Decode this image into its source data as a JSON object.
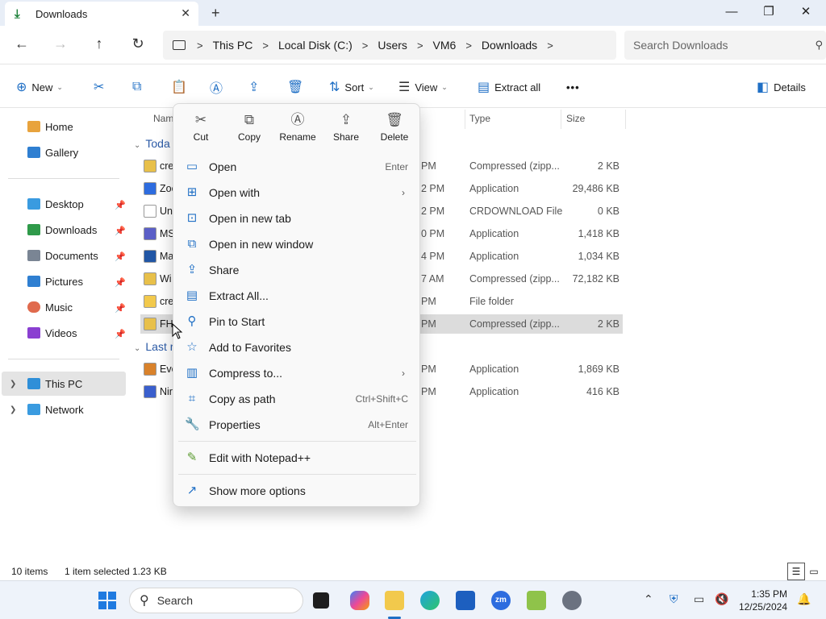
{
  "window": {
    "tab_title": "Downloads",
    "close_tab": "✕",
    "new_tab": "+",
    "minimize": "—",
    "maximize": "❐",
    "close": "✕"
  },
  "address": {
    "back": "←",
    "forward": "→",
    "up": "↑",
    "refresh": "↻",
    "crumbs": [
      "This PC",
      "Local Disk (C:)",
      "Users",
      "VM6",
      "Downloads"
    ],
    "separator": ">",
    "search_placeholder": "Search Downloads"
  },
  "commandbar": {
    "new": "New",
    "sort": "Sort",
    "view": "View",
    "extract_all": "Extract all",
    "more": "•••",
    "details": "Details"
  },
  "sidebar": {
    "quick": [
      {
        "label": "Home",
        "color": "#e8a33d"
      },
      {
        "label": "Gallery",
        "color": "#2f7fd1"
      }
    ],
    "pinned": [
      {
        "label": "Desktop",
        "color": "#3a9be0"
      },
      {
        "label": "Downloads",
        "color": "#2f9a4a"
      },
      {
        "label": "Documents",
        "color": "#7a8594"
      },
      {
        "label": "Pictures",
        "color": "#2f7fd1"
      },
      {
        "label": "Music",
        "color": "#e06a4d"
      },
      {
        "label": "Videos",
        "color": "#8a3fd1"
      }
    ],
    "pin_glyph": "📌",
    "this_pc": "This PC",
    "network": "Network"
  },
  "list": {
    "headers": {
      "name": "Nam",
      "type": "Type",
      "size": "Size"
    },
    "groups": {
      "today": "Toda",
      "last": "Last r"
    },
    "rows": [
      {
        "name": "cre",
        "date": "PM",
        "type": "Compressed (zipp...",
        "size": "2 KB",
        "color": "#e8c04a"
      },
      {
        "name": "Zoo",
        "date": "2 PM",
        "type": "Application",
        "size": "29,486 KB",
        "color": "#2d6cdf"
      },
      {
        "name": "Un",
        "date": "2 PM",
        "type": "CRDOWNLOAD File",
        "size": "0 KB",
        "color": "#ffffff"
      },
      {
        "name": "MS",
        "date": "0 PM",
        "type": "Application",
        "size": "1,418 KB",
        "color": "#5b5fc7"
      },
      {
        "name": "Ma",
        "date": "4 PM",
        "type": "Application",
        "size": "1,034 KB",
        "color": "#2156a5"
      },
      {
        "name": "Wi",
        "date": "7 AM",
        "type": "Compressed (zipp...",
        "size": "72,182 KB",
        "color": "#e8c04a"
      },
      {
        "name": "cre",
        "date": "PM",
        "type": "File folder",
        "size": "",
        "color": "#f2c94c"
      },
      {
        "name": "FH",
        "date": "PM",
        "type": "Compressed (zipp...",
        "size": "2 KB",
        "color": "#e8c04a"
      }
    ],
    "last_rows": [
      {
        "name": "Eve",
        "date": "PM",
        "type": "Application",
        "size": "1,869 KB",
        "color": "#d9822b"
      },
      {
        "name": "Nir",
        "date": "PM",
        "type": "Application",
        "size": "416 KB",
        "color": "#3a5fcd"
      }
    ]
  },
  "context_menu": {
    "quick_actions": [
      {
        "label": "Cut",
        "glyph": "✂"
      },
      {
        "label": "Copy",
        "glyph": "⧉"
      },
      {
        "label": "Rename",
        "glyph": "Ⓐ"
      },
      {
        "label": "Share",
        "glyph": "⇪"
      },
      {
        "label": "Delete",
        "glyph": "🗑"
      }
    ],
    "items": [
      {
        "label": "Open",
        "shortcut": "Enter",
        "glyph": "▭"
      },
      {
        "label": "Open with",
        "arrow": "›",
        "glyph": "⊞"
      },
      {
        "label": "Open in new tab",
        "glyph": "⊡"
      },
      {
        "label": "Open in new window",
        "glyph": "⧉"
      },
      {
        "label": "Share",
        "glyph": "⇪"
      },
      {
        "label": "Extract All...",
        "glyph": "▤"
      },
      {
        "label": "Pin to Start",
        "glyph": "⚲"
      },
      {
        "label": "Add to Favorites",
        "glyph": "☆"
      },
      {
        "label": "Compress to...",
        "arrow": "›",
        "glyph": "▥"
      },
      {
        "label": "Copy as path",
        "shortcut": "Ctrl+Shift+C",
        "glyph": "⌗"
      },
      {
        "label": "Properties",
        "shortcut": "Alt+Enter",
        "glyph": "🔧"
      }
    ],
    "notepad": {
      "label": "Edit with Notepad++",
      "glyph": "✎"
    },
    "more": {
      "label": "Show more options",
      "glyph": "↗"
    }
  },
  "status": {
    "count": "10 items",
    "selected": "1 item selected",
    "size": "1.23 KB"
  },
  "taskbar": {
    "search": "Search",
    "time": "1:35 PM",
    "date": "12/25/2024"
  }
}
